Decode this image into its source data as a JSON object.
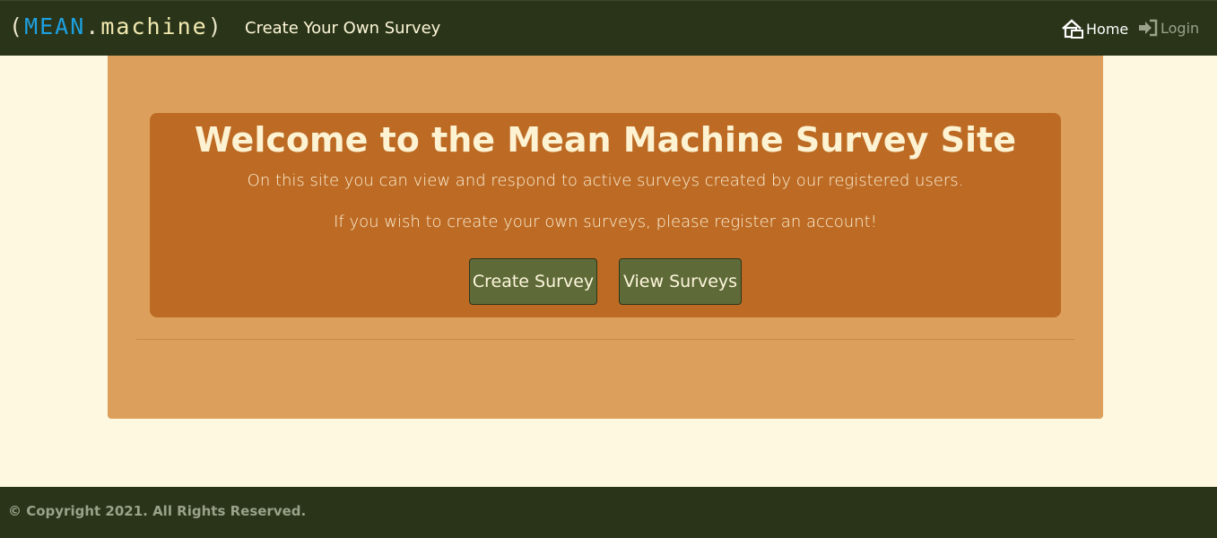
{
  "navbar": {
    "brand": {
      "open_paren": "(",
      "mean": "MEAN",
      "dot": ".",
      "machine": "machine",
      "close_paren": ")"
    },
    "title": "Create Your Own Survey",
    "links": {
      "home": {
        "label": "Home",
        "icon": "home-icon"
      },
      "login": {
        "label": "Login",
        "icon": "login-icon"
      }
    }
  },
  "hero": {
    "heading": "Welcome to the Mean Machine Survey Site",
    "line1": "On this site you can view and respond to active surveys created by our registered users.",
    "line2": "If you wish to create your own surveys, please register an account!",
    "buttons": {
      "create": "Create Survey",
      "view": "View Surveys"
    }
  },
  "footer": {
    "copyright": "© Copyright 2021. All Rights Reserved."
  },
  "colors": {
    "navbar_bg": "#293419",
    "page_bg": "#fef8e0",
    "card_bg": "#dca05c",
    "hero_bg": "#bd6b24",
    "button_bg": "#5e6b39",
    "brand_accent": "#1ea0e0"
  }
}
